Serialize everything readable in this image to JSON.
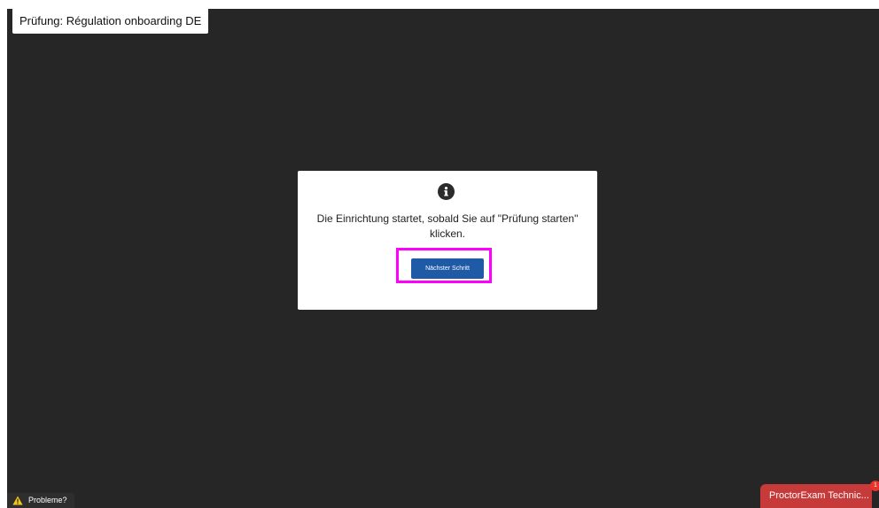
{
  "exam": {
    "title": "Prüfung: Régulation onboarding DE"
  },
  "dialog": {
    "icon": "info-icon",
    "message": "Die Einrichtung startet, sobald Sie auf \"Prüfung starten\" klicken.",
    "next_label": "Nächster Schritt",
    "highlight_color": "#ff00ff",
    "button_color": "#1f5aa6"
  },
  "footer": {
    "problems_icon": "warning-icon",
    "problems_label": "Probleme?"
  },
  "support_chat": {
    "label": "ProctorExam Technic...",
    "badge_count": "1",
    "color": "#c63a3a"
  },
  "colors": {
    "background": "#262626",
    "dialog_bg": "#ffffff"
  }
}
